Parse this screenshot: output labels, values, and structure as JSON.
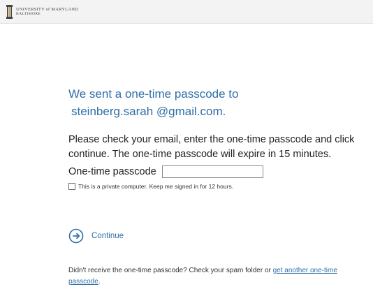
{
  "header": {
    "logo_line1": "UNIVERSITY of MARYLAND",
    "logo_line2": "BALTIMORE",
    "logo_icon": "university-column-logo"
  },
  "main": {
    "heading_line1": "We sent a one-time passcode to",
    "heading_email": "steinberg.sarah @gmail.com.",
    "instructions": "Please check your email, enter the one-time passcode and click continue. The one-time passcode will expire in 15 minutes.",
    "otp_label": "One-time passcode",
    "otp_value": "",
    "remember_label": "This is a private computer. Keep me signed in for 12 hours.",
    "remember_checked": false,
    "continue_label": "Continue",
    "continue_icon": "arrow-right-circle-icon",
    "resend_prefix": "Didn't receive the one-time passcode? Check your spam folder or ",
    "resend_link": "get another one-time passcode",
    "resend_suffix": "."
  },
  "colors": {
    "accent": "#2f6fa8",
    "header_bg": "#f3f3f3",
    "text": "#222222"
  }
}
